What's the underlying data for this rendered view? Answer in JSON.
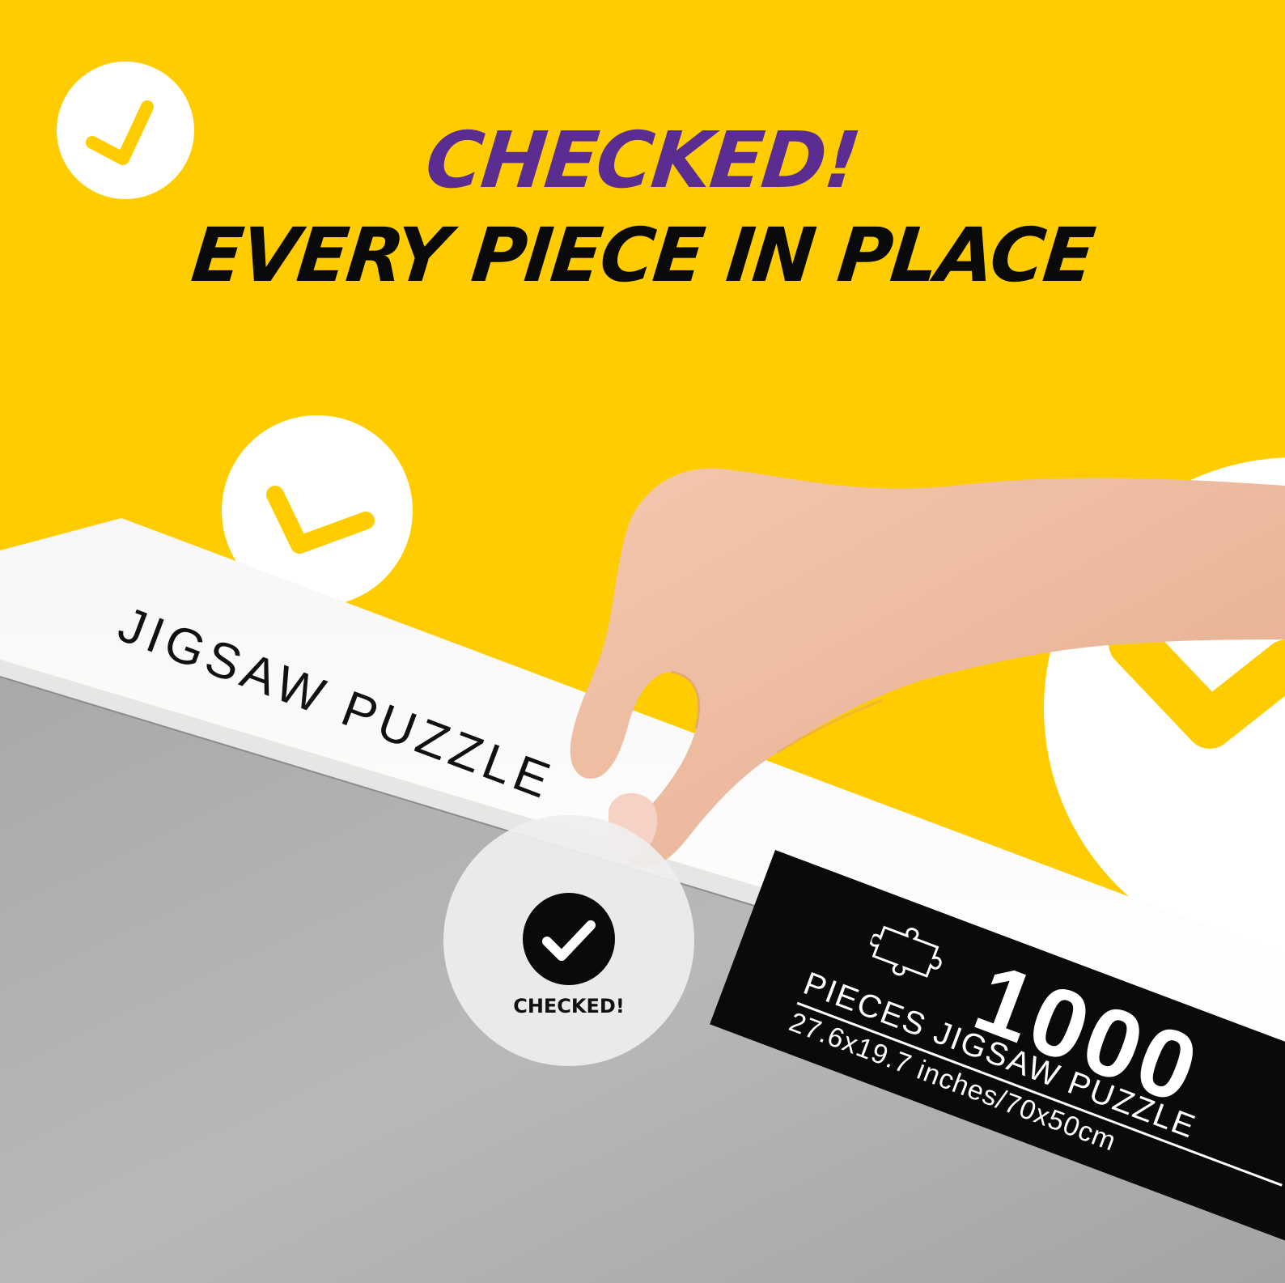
{
  "headline": {
    "line1": "CHECKED!",
    "line2": "Every Piece In Place"
  },
  "colors": {
    "background": "#FFCC00",
    "headline_accent": "#5B2D91",
    "headline_main": "#0A0A0A",
    "check_circle": "#FFFFFF",
    "check_mark": "#FFCC00"
  },
  "box": {
    "side_label": "JIGSAW PUZZLE",
    "spec_panel": {
      "count": "1000",
      "line1": "PIECES JIGSAW PUZZLE",
      "line2": "27.6x19.7 inches/70x50cm"
    }
  },
  "stamp": {
    "label": "CHECKED!",
    "icon": "check-circle-icon"
  },
  "decorations": {
    "icons": [
      "check-icon",
      "check-icon",
      "check-icon"
    ]
  }
}
